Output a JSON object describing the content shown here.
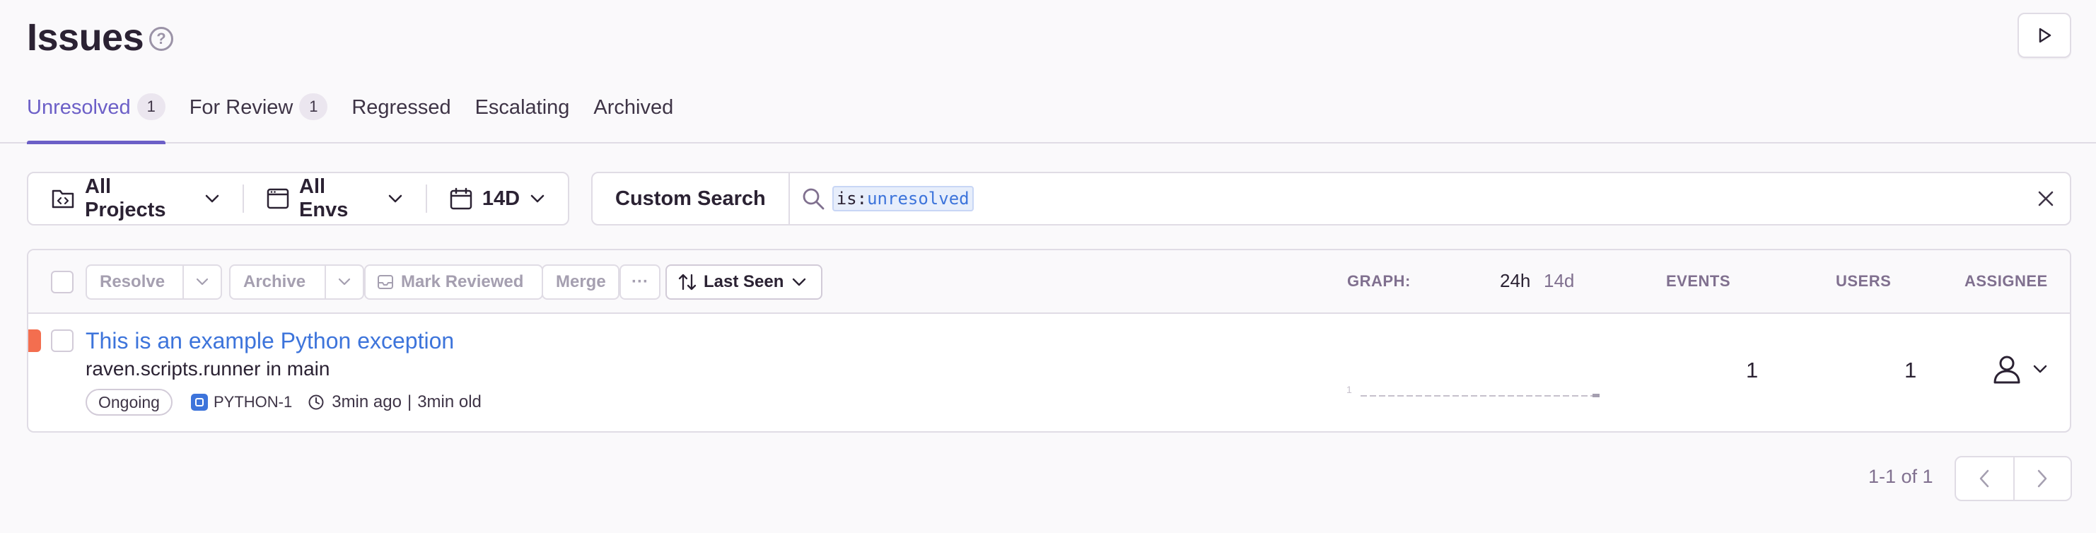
{
  "header": {
    "title": "Issues",
    "help_icon": "question-circle-icon",
    "replay_icon": "play-icon"
  },
  "tabs": [
    {
      "label": "Unresolved",
      "count": "1",
      "active": true
    },
    {
      "label": "For Review",
      "count": "1",
      "active": false
    },
    {
      "label": "Regressed",
      "active": false
    },
    {
      "label": "Escalating",
      "active": false
    },
    {
      "label": "Archived",
      "active": false
    }
  ],
  "filters": {
    "projects": "All Projects",
    "envs": "All Envs",
    "date": "14D"
  },
  "search": {
    "custom_label": "Custom Search",
    "token_key": "is:",
    "token_value": "unresolved"
  },
  "toolbar": {
    "resolve": "Resolve",
    "archive": "Archive",
    "mark_reviewed": "Mark Reviewed",
    "merge": "Merge",
    "more": "···",
    "sort": "Last Seen"
  },
  "columns": {
    "graph": "GRAPH:",
    "period_24h": "24h",
    "period_14d": "14d",
    "events": "EVENTS",
    "users": "USERS",
    "assignee": "ASSIGNEE"
  },
  "issues": [
    {
      "title": "This is an example Python exception",
      "culprit": "raven.scripts.runner in main",
      "status": "Ongoing",
      "short_id": "PYTHON-1",
      "last_seen": "3min ago",
      "first_seen": "3min old",
      "graph_max_label": "1",
      "events": "1",
      "users": "1",
      "level_color": "#f36e4f"
    }
  ],
  "pagination": {
    "caption": "1-1 of 1"
  },
  "colors": {
    "accent": "#6c5fc7",
    "link": "#3d74db",
    "error_level": "#f36e4f"
  }
}
